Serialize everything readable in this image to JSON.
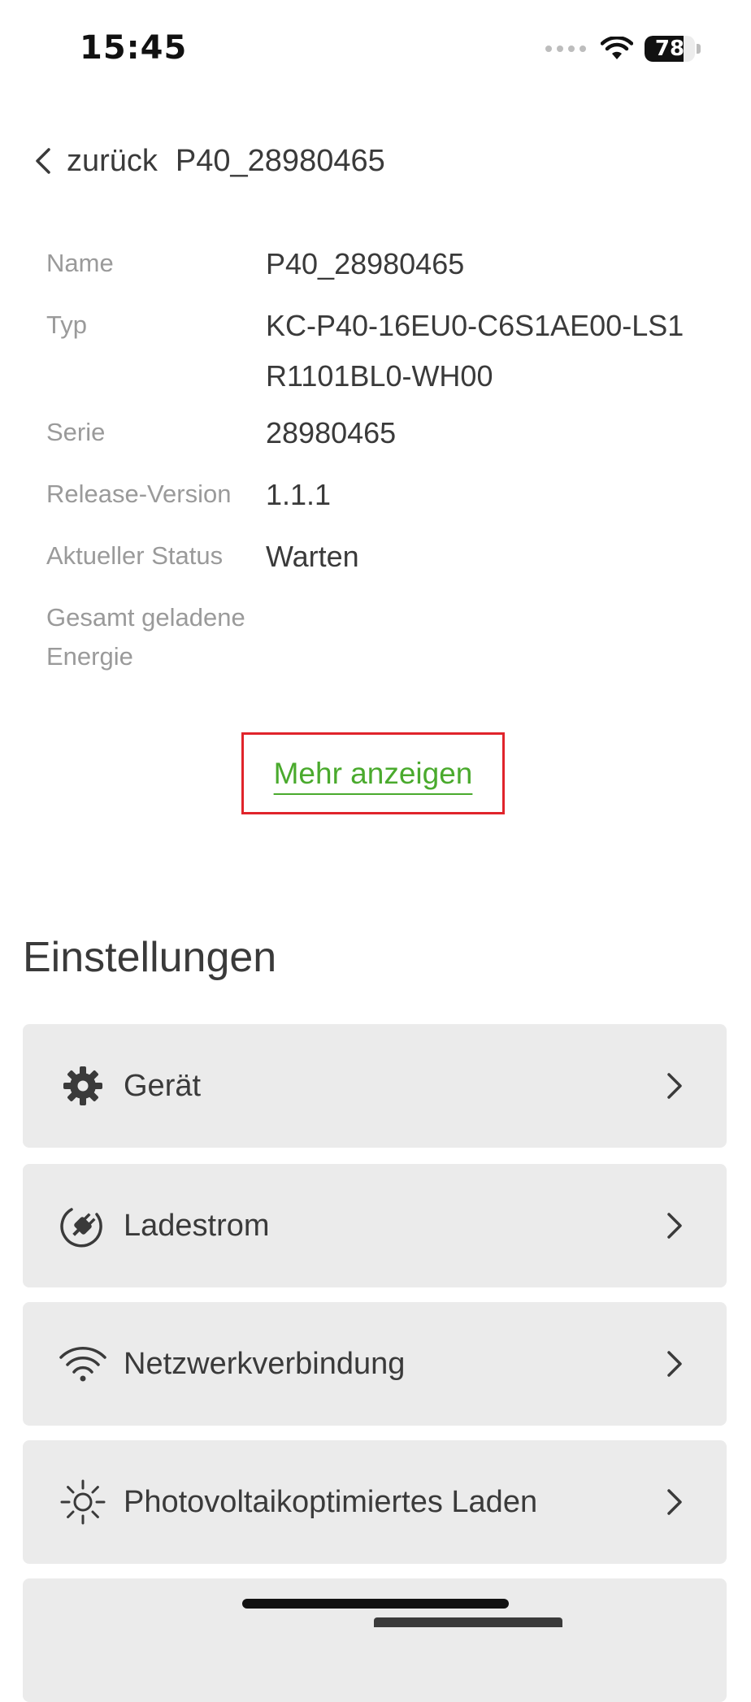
{
  "status_bar": {
    "time": "15:45",
    "battery_level": "78",
    "battery_fraction": 0.78,
    "signal_icon": "signal-dots-icon",
    "wifi_icon": "wifi-icon"
  },
  "header": {
    "back_label": "zurück",
    "title": "P40_28980465"
  },
  "info": {
    "name_label": "Name",
    "name_value": "P40_28980465",
    "type_label": "Typ",
    "type_value_line1": "KC-P40-16EU0-C6S1AE00-LS1",
    "type_value_line2": "R1101BL0-WH00",
    "serie_label": "Serie",
    "serie_value": "28980465",
    "release_label": "Release-Version",
    "release_value": "1.1.1",
    "status_label": "Aktueller Status",
    "status_value": "Warten",
    "energy_label_line1": "Gesamt geladene",
    "energy_label_line2": "Energie",
    "energy_value": ""
  },
  "show_more": {
    "label": "Mehr anzeigen",
    "highlight_color": "#e0242b",
    "link_color": "#4aaa2d"
  },
  "settings": {
    "title": "Einstellungen",
    "items": [
      {
        "label": "Gerät",
        "icon": "gear-icon"
      },
      {
        "label": "Ladestrom",
        "icon": "plug-icon"
      },
      {
        "label": "Netzwerkverbindung",
        "icon": "wifi-icon"
      },
      {
        "label": "Photovoltaikoptimiertes Laden",
        "icon": "sun-icon"
      }
    ]
  }
}
